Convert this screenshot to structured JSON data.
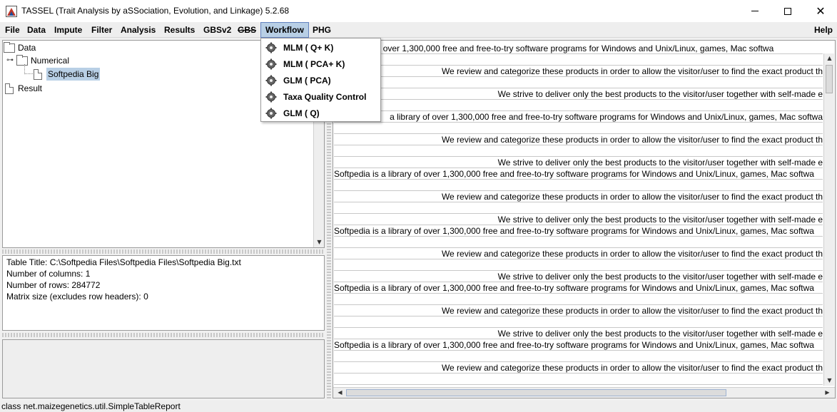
{
  "window": {
    "title": "TASSEL (Trait Analysis by aSSociation, Evolution, and Linkage) 5.2.68",
    "minimize": "—",
    "maximize": "☐",
    "close": "✕"
  },
  "menu": {
    "file": "File",
    "data": "Data",
    "impute": "Impute",
    "filter": "Filter",
    "analysis": "Analysis",
    "results": "Results",
    "gbsv2": "GBSv2",
    "gbs": "GBS",
    "workflow": "Workflow",
    "phg": "PHG",
    "help": "Help"
  },
  "tree": {
    "data": "Data",
    "numerical": "Numerical",
    "softpedia_big": "Softpedia Big",
    "result": "Result"
  },
  "info": {
    "line1": "Table Title: C:\\Softpedia Files\\Softpedia Files\\Softpedia Big.txt",
    "line2": "Number of columns: 1",
    "line3": "Number of rows: 284772",
    "line4": "Matrix size (excludes row headers): 0"
  },
  "workflow_menu": {
    "item1": "MLM ( Q+ K)",
    "item2": "MLM ( PCA+ K)",
    "item3": "GLM ( PCA)",
    "item4": "Taxa  Quality  Control",
    "item5": "GLM ( Q)"
  },
  "table": {
    "row0_partial": "s a library of over 1,300,000 free and free-to-try software programs for Windows and Unix/Linux, games, Mac softwa",
    "line_library_cut": "a library of over 1,300,000 free and free-to-try software programs for Windows and Unix/Linux, games, Mac softwa",
    "line_library": "Softpedia is a library of over 1,300,000 free and free-to-try software programs for Windows and Unix/Linux, games, Mac softwa",
    "line_review": "We review and categorize these products in order to allow the visitor/user to find the exact product th",
    "line_strive": "We strive to deliver only the best products to the visitor/user together with self-made e"
  },
  "status": {
    "text": "class net.maizegenetics.util.SimpleTableReport"
  },
  "icons": {
    "gear": "gear-icon",
    "folder": "folder-icon",
    "file": "file-icon"
  }
}
